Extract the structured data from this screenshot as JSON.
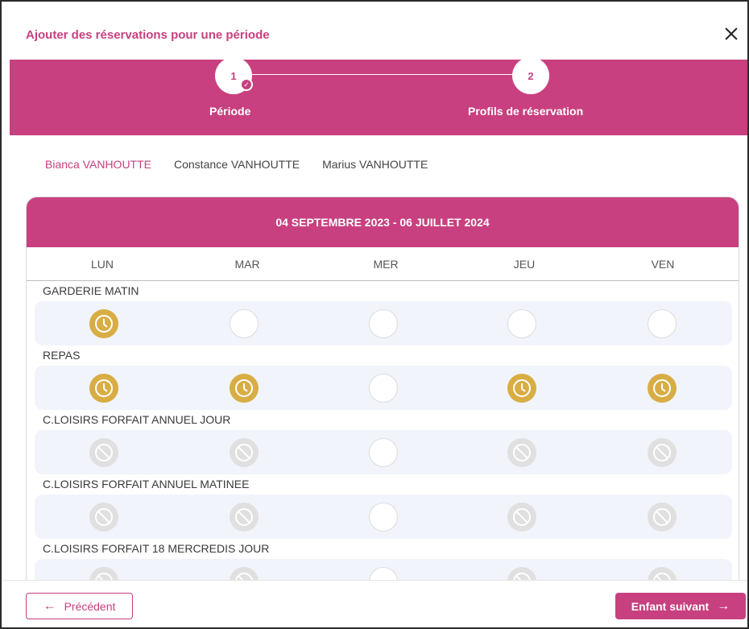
{
  "dialog": {
    "title": "Ajouter des réservations pour une période",
    "close_icon": "close-icon"
  },
  "stepper": {
    "steps": [
      {
        "number": "1",
        "label": "Période",
        "completed": true
      },
      {
        "number": "2",
        "label": "Profils de réservation",
        "completed": false
      }
    ]
  },
  "children": [
    {
      "name": "Bianca VANHOUTTE",
      "active": true
    },
    {
      "name": "Constance VANHOUTTE",
      "active": false
    },
    {
      "name": "Marius VANHOUTTE",
      "active": false
    }
  ],
  "calendar": {
    "period": "04 SEPTEMBRE 2023 - 06 JUILLET 2024",
    "days": [
      "LUN",
      "MAR",
      "MER",
      "JEU",
      "VEN"
    ],
    "services": [
      {
        "name": "GARDERIE MATIN",
        "states": [
          "selected",
          "empty",
          "empty",
          "empty",
          "empty"
        ]
      },
      {
        "name": "REPAS",
        "states": [
          "selected",
          "selected",
          "empty",
          "selected",
          "selected"
        ]
      },
      {
        "name": "C.LOISIRS FORFAIT ANNUEL JOUR",
        "states": [
          "disabled",
          "disabled",
          "empty",
          "disabled",
          "disabled"
        ]
      },
      {
        "name": "C.LOISIRS FORFAIT ANNUEL MATINEE",
        "states": [
          "disabled",
          "disabled",
          "empty",
          "disabled",
          "disabled"
        ]
      },
      {
        "name": "C.LOISIRS FORFAIT 18 MERCREDIS JOUR",
        "states": [
          "disabled",
          "disabled",
          "empty",
          "disabled",
          "disabled"
        ]
      }
    ]
  },
  "footer": {
    "prev_label": "Précédent",
    "next_label": "Enfant suivant"
  },
  "colors": {
    "accent": "#c8407f",
    "selected": "#d8ad44",
    "disabled": "#e0e0e0"
  }
}
